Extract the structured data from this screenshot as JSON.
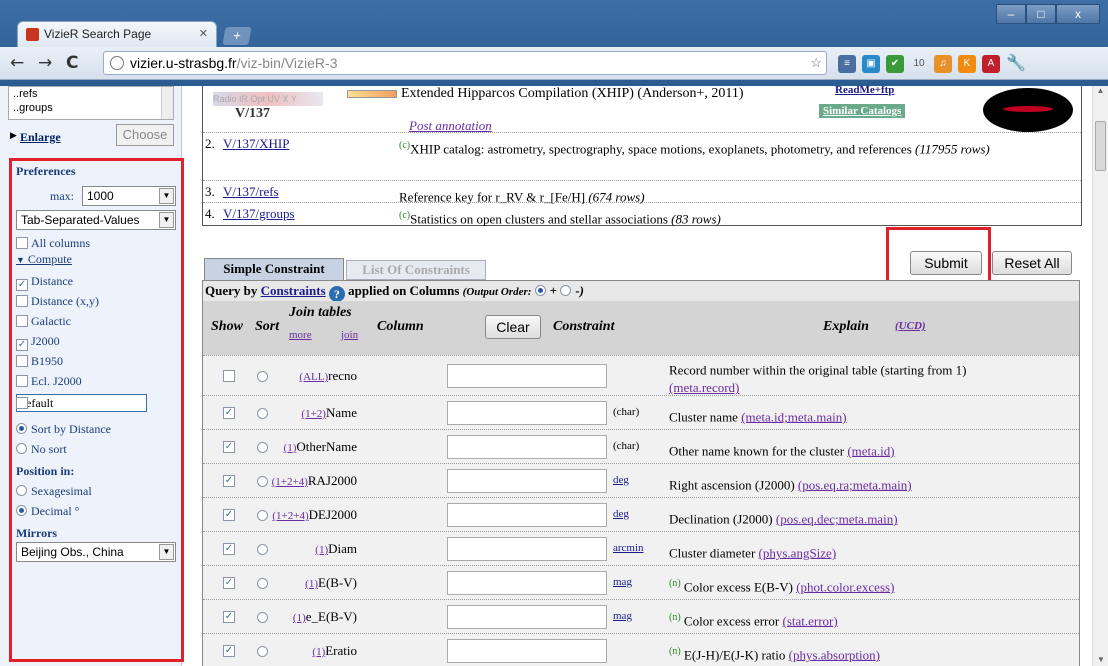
{
  "browser": {
    "tab_title": "VizieR Search Page",
    "new_tab": "+",
    "url_host": "vizier.u-strasbg.fr",
    "url_path": "/viz-bin/VizieR-3",
    "win_min": "–",
    "win_max": "□",
    "win_close": "x"
  },
  "sidebar": {
    "list_items": [
      "..refs",
      "..groups"
    ],
    "enlarge": "Enlarge",
    "choose": "Choose",
    "preferences": "Preferences",
    "max_label": "max:",
    "max_value": "1000",
    "format": "Tab-Separated-Values",
    "all_columns": "All columns",
    "compute": "Compute",
    "options": [
      {
        "label": "Distance",
        "checked": true
      },
      {
        "label": "Distance (x,y)",
        "checked": false
      },
      {
        "label": "Galactic",
        "checked": false
      },
      {
        "label": "J2000",
        "checked": true
      },
      {
        "label": "B1950",
        "checked": false
      },
      {
        "label": "Ecl. J2000",
        "checked": false
      }
    ],
    "default_field": "default",
    "sort_by_distance": "Sort by Distance",
    "no_sort": "No sort",
    "position_in": "Position in:",
    "sexagesimal": "Sexagesimal",
    "decimal": "Decimal °",
    "mirrors": "Mirrors",
    "mirror_value": "Beijing Obs., China"
  },
  "catalog": {
    "wavebands": "Radio IR Opt UV X Y",
    "id": "V/137",
    "title": "Extended Hipparcos Compilation (XHIP) (Anderson+, 2011)",
    "readme": "ReadMe+ftp",
    "similar": "Similar Catalogs",
    "post_annotation": "Post annotation",
    "tables": [
      {
        "num": "2.",
        "name": "V/137/XHIP",
        "desc_c": "(c)",
        "desc": "XHIP catalog: astrometry, spectrography, space motions, exoplanets, photometry, and references",
        "rows": "(117955 rows)"
      },
      {
        "num": "3.",
        "name": "V/137/refs",
        "desc_c": "",
        "desc": "Reference key for r_RV & r_[Fe/H]",
        "rows": "(674 rows)"
      },
      {
        "num": "4.",
        "name": "V/137/groups",
        "desc_c": "(c)",
        "desc": "Statistics on open clusters and stellar associations",
        "rows": "(83 rows)"
      }
    ]
  },
  "query": {
    "tab_simple": "Simple Constraint",
    "tab_list": "List Of Constraints",
    "submit": "Submit",
    "reset_all": "Reset All",
    "query_by": "Query by",
    "constraints": "Constraints",
    "applied_on": "applied on Columns",
    "output_order": "(Output Order:",
    "plus": "+",
    "minus": "-)",
    "col_show": "Show",
    "col_sort": "Sort",
    "col_join": "Join tables",
    "join_more": "more",
    "join_join": "join",
    "col_column": "Column",
    "clear": "Clear",
    "col_constraint": "Constraint",
    "col_explain": "Explain",
    "ucd": "(UCD)",
    "rows": [
      {
        "checked": false,
        "tag": "(ALL)",
        "name": "recno",
        "unit": "",
        "n": "",
        "explain": "Record number within the original table (starting from 1)",
        "ucd": "(meta.record)"
      },
      {
        "checked": true,
        "tag": "(1+2)",
        "name": "Name",
        "unit": "(char)",
        "n": "",
        "explain": "Cluster name",
        "ucd": "(meta.id;meta.main)"
      },
      {
        "checked": true,
        "tag": "(1)",
        "name": "OtherName",
        "unit": "(char)",
        "n": "",
        "explain": "Other name known for the cluster",
        "ucd": "(meta.id)"
      },
      {
        "checked": true,
        "tag": "(1+2+4)",
        "name": "RAJ2000",
        "unit": "deg",
        "n": "",
        "explain": "Right ascension (J2000)",
        "ucd": "(pos.eq.ra;meta.main)"
      },
      {
        "checked": true,
        "tag": "(1+2+4)",
        "name": "DEJ2000",
        "unit": "deg",
        "n": "",
        "explain": "Declination (J2000)",
        "ucd": "(pos.eq.dec;meta.main)"
      },
      {
        "checked": true,
        "tag": "(1)",
        "name": "Diam",
        "unit": "arcmin",
        "n": "",
        "explain": "Cluster diameter",
        "ucd": "(phys.angSize)"
      },
      {
        "checked": true,
        "tag": "(1)",
        "name": "E(B-V)",
        "unit": "mag",
        "n": "(n)",
        "explain": "Color excess E(B-V)",
        "ucd": "(phot.color.excess)"
      },
      {
        "checked": true,
        "tag": "(1)",
        "name": "e_E(B-V)",
        "unit": "mag",
        "n": "(n)",
        "explain": "Color excess error",
        "ucd": "(stat.error)"
      },
      {
        "checked": true,
        "tag": "(1)",
        "name": "Eratio",
        "unit": "",
        "n": "(n)",
        "explain": "E(J-H)/E(J-K) ratio",
        "ucd": "(phys.absorption)"
      }
    ]
  }
}
